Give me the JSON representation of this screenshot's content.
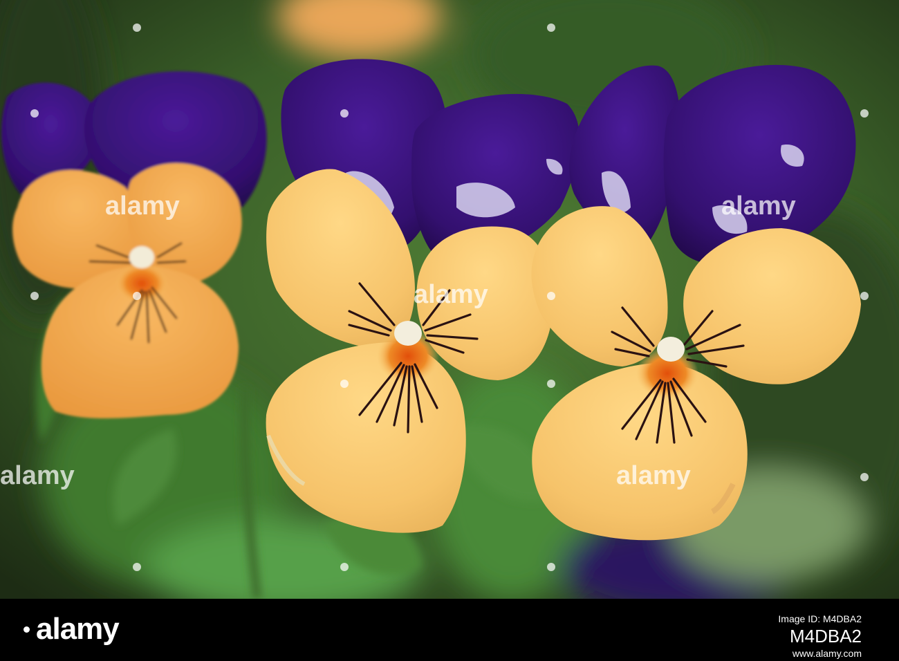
{
  "scene": {
    "subject": "viola flowers",
    "colors": {
      "background_green": "#3f6b2c",
      "background_dark": "#1f3016",
      "upper_petal_purple": "#35107a",
      "lower_petal_yellow": "#f6c66a",
      "left_flower_orange": "#f3a94e",
      "throat_orange": "#e36a14",
      "vein_dark": "#2b1a1a",
      "footer": "#000000"
    }
  },
  "watermark": {
    "text": "alamy"
  },
  "footer": {
    "logo": "alamy",
    "image_id_label": "Image ID: M4DBA2",
    "image_id": "M4DBA2",
    "site": "www.alamy.com"
  }
}
